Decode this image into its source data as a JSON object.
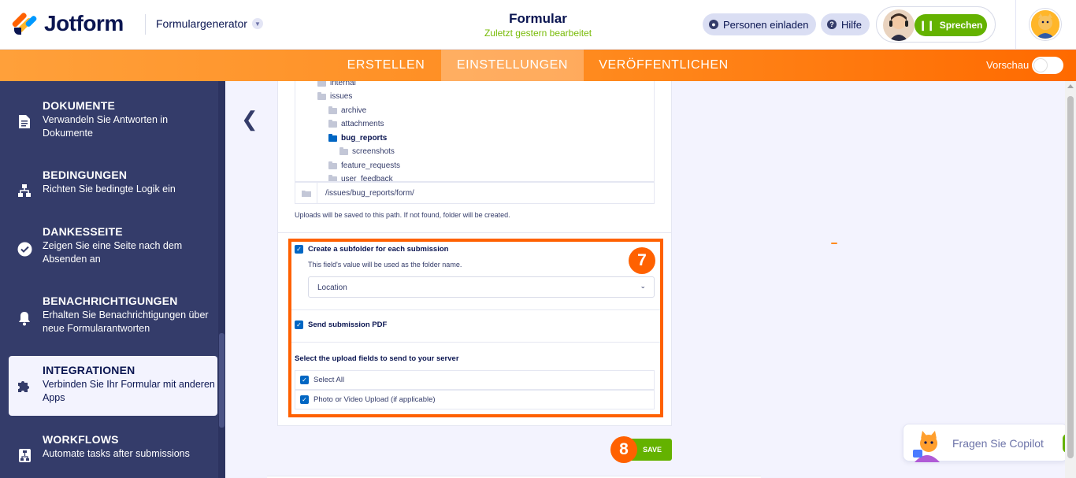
{
  "header": {
    "logo_text": "Jotform",
    "form_generator": "Formulargenerator",
    "form_title": "Formular",
    "form_subtitle": "Zuletzt gestern bearbeitet",
    "invite_label": "Personen einladen",
    "help_label": "Hilfe",
    "speak_label": "Sprechen"
  },
  "nav": {
    "tabs": [
      {
        "label": "ERSTELLEN",
        "active": false
      },
      {
        "label": "EINSTELLUNGEN",
        "active": true
      },
      {
        "label": "VERÖFFENTLICHEN",
        "active": false
      }
    ],
    "preview_label": "Vorschau",
    "preview_on": false
  },
  "sidebar": {
    "items": [
      {
        "title": "DOKUMENTE",
        "desc": "Verwandeln Sie Antworten in Dokumente",
        "icon": "document-icon"
      },
      {
        "title": "BEDINGUNGEN",
        "desc": "Richten Sie bedingte Logik ein",
        "icon": "conditions-icon"
      },
      {
        "title": "DANKESSEITE",
        "desc": "Zeigen Sie eine Seite nach dem Absenden an",
        "icon": "check-circle-icon"
      },
      {
        "title": "BENACHRICHTIGUNGEN",
        "desc": "Erhalten Sie Benachrichtigungen über neue Formularantworten",
        "icon": "bell-icon"
      },
      {
        "title": "INTEGRATIONEN",
        "desc": "Verbinden Sie Ihr Formular mit anderen Apps",
        "icon": "puzzle-icon",
        "active": true
      },
      {
        "title": "WORKFLOWS",
        "desc": "Automate tasks after submissions",
        "icon": "workflow-icon"
      }
    ]
  },
  "panel": {
    "folders": [
      {
        "name": "internal",
        "level": 0
      },
      {
        "name": "issues",
        "level": 0
      },
      {
        "name": "archive",
        "level": 1
      },
      {
        "name": "attachments",
        "level": 1
      },
      {
        "name": "bug_reports",
        "level": 1,
        "selected": true
      },
      {
        "name": "screenshots",
        "level": 2
      },
      {
        "name": "feature_requests",
        "level": 1
      },
      {
        "name": "user_feedback",
        "level": 1
      }
    ],
    "path_value": "/issues/bug_reports/form/",
    "path_hint": "Uploads will be saved to this path. If not found, folder will be created.",
    "subfolder_label": "Create a subfolder for each submission",
    "subfolder_checked": true,
    "subfolder_hint": "This field's value will be used as the folder name.",
    "subfolder_field": "Location",
    "send_pdf_label": "Send submission PDF",
    "send_pdf_checked": true,
    "upload_fields_label": "Select the upload fields to send to your server",
    "upload_options": [
      {
        "label": "Select All",
        "checked": true
      },
      {
        "label": "Photo or Video Upload (if applicable)",
        "checked": true
      }
    ],
    "save_label": "SAVE"
  },
  "annotations": {
    "step_7": "7",
    "step_8": "8"
  },
  "copilot": {
    "label": "Fragen Sie Copilot"
  },
  "colors": {
    "brand_orange": "#ff6100",
    "navy": "#0a1551",
    "sidebar_bg": "#343c6a",
    "green": "#64b200",
    "checkbox_blue": "#0066c3"
  }
}
